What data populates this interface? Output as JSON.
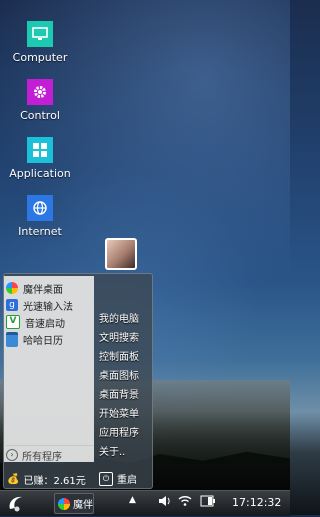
{
  "desktop": {
    "icons": [
      {
        "label": "Computer",
        "color": "#1dc9b0",
        "icon": "monitor-icon"
      },
      {
        "label": "Control",
        "color": "#c21ed6",
        "icon": "gear-icon"
      },
      {
        "label": "Application",
        "color": "#1cc0d9",
        "icon": "grid-icon"
      },
      {
        "label": "Internet",
        "color": "#2b78e4",
        "icon": "globe-icon"
      }
    ]
  },
  "start_menu": {
    "pinned": [
      {
        "label": "魔伴桌面",
        "icon": "mobanzhuomian-icon"
      },
      {
        "label": "光速输入法",
        "icon": "input-method-icon"
      },
      {
        "label": "音速启动",
        "icon": "launcher-icon"
      },
      {
        "label": "哈哈日历",
        "icon": "calendar-icon"
      }
    ],
    "all_programs": "所有程序",
    "right_items": [
      "我的电脑",
      "文明搜索",
      "控制面板",
      "桌面图标",
      "桌面背景",
      "开始菜单",
      "应用程序",
      "关于.."
    ],
    "earned": "已赚：2.61元",
    "restart": "重启"
  },
  "taskbar": {
    "task_label": "魔伴",
    "clock": "17:12:32"
  }
}
